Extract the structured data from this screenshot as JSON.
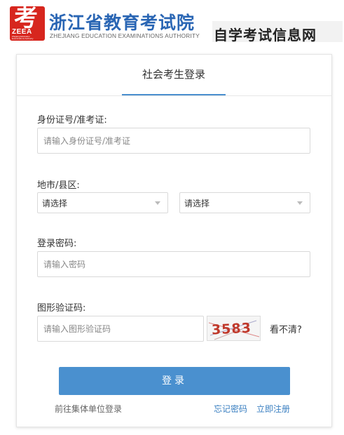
{
  "header": {
    "logo_char": "考",
    "logo_abbr": "ZEEA",
    "logo_tiny": "Zhejiang Education Examinations Authority",
    "org_name": "浙江省教育考试院",
    "org_subtitle": "ZHEJIANG EDUCATION EXAMINATIONS AUTHORITY",
    "site_tag": "自学考试信息网"
  },
  "tabs": {
    "active_label": "社会考生登录"
  },
  "form": {
    "id_label": "身份证号/准考证:",
    "id_placeholder": "请输入身份证号/准考证",
    "region_label": "地市/县区:",
    "city_value": "请选择",
    "county_value": "请选择",
    "password_label": "登录密码:",
    "password_placeholder": "请输入密码",
    "captcha_label": "图形验证码:",
    "captcha_placeholder": "请输入图形验证码",
    "captcha_text": "3583",
    "refresh_label": "看不清?"
  },
  "actions": {
    "login_label": "登录",
    "group_login": "前往集体单位登录",
    "forgot_password": "忘记密码",
    "register": "立即注册"
  },
  "colors": {
    "brand_blue": "#2a66b4",
    "button_blue": "#4a90cf",
    "logo_red": "#d7261e"
  }
}
